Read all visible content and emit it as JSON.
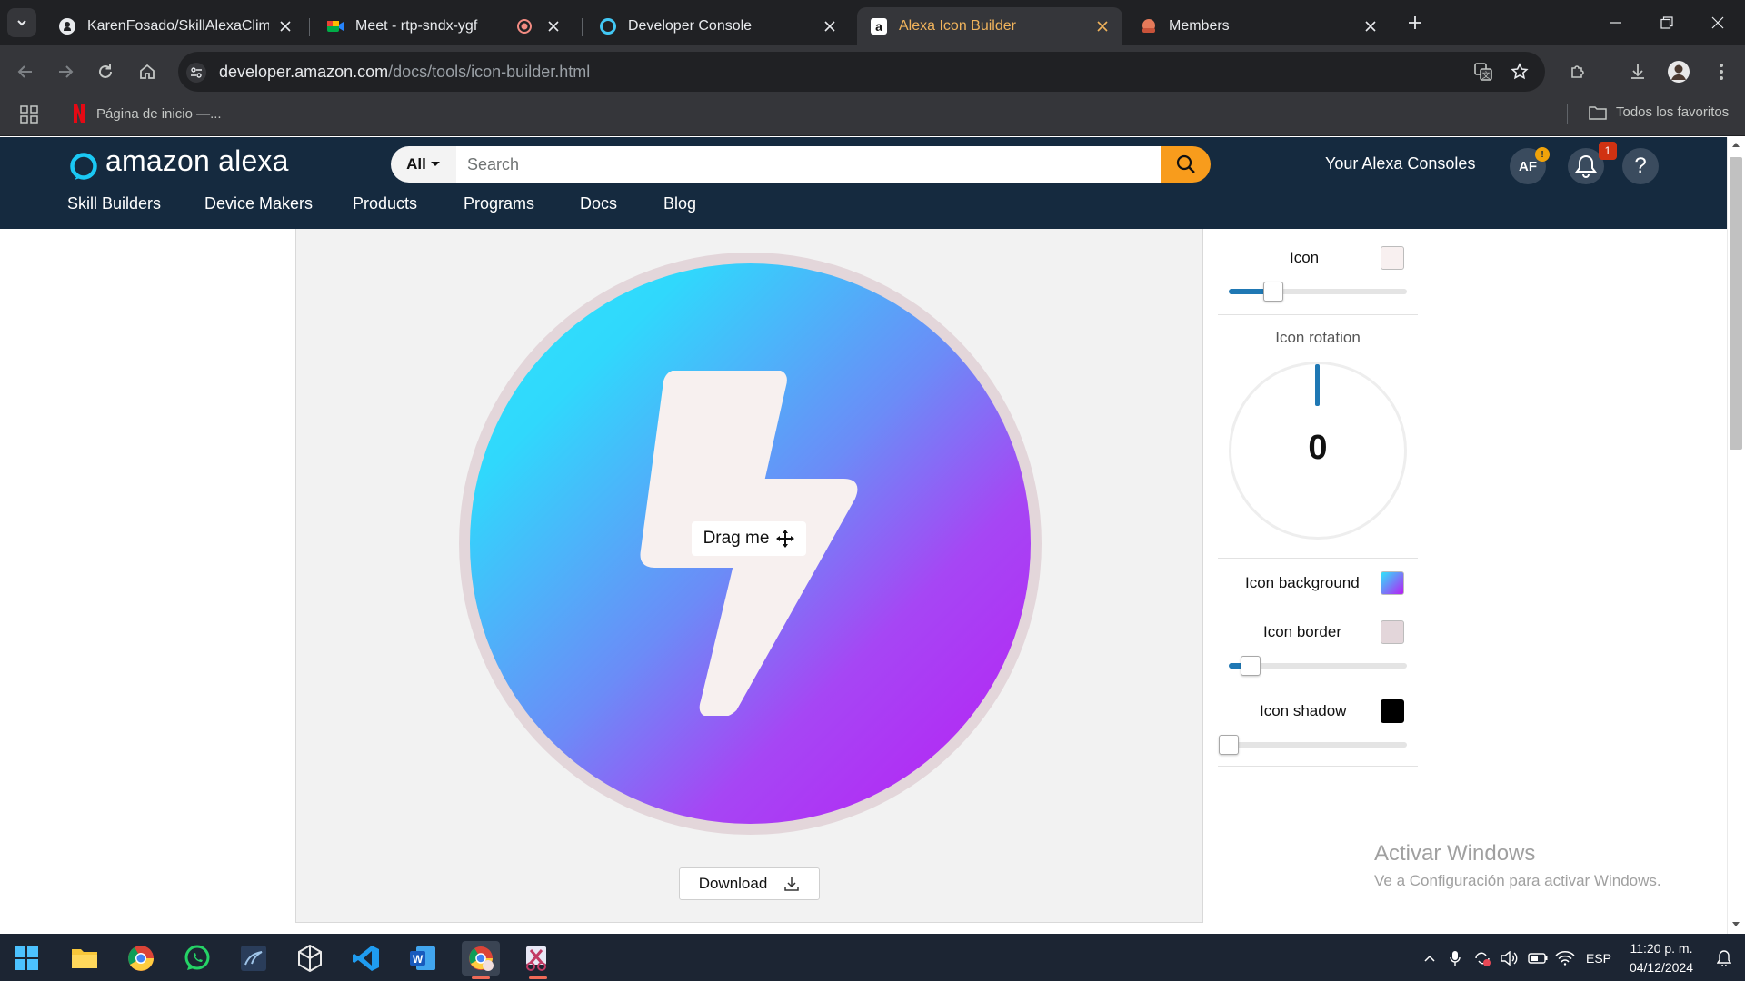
{
  "browser": {
    "tabs": [
      {
        "title": "KarenFosado/SkillAlexaClima: C",
        "icon": "github-icon"
      },
      {
        "title": "Meet - rtp-sndx-ygf",
        "icon": "meet-icon",
        "recording": true
      },
      {
        "title": "Developer Console",
        "icon": "alexa-ring-icon"
      },
      {
        "title": "Alexa Icon Builder",
        "icon": "amazon-icon",
        "active": true
      },
      {
        "title": "Members",
        "icon": "members-icon"
      }
    ],
    "url_host": "developer.amazon.com",
    "url_path": "/docs/tools/icon-builder.html",
    "bookmarks": {
      "netflix": "Página de inicio —...",
      "all_favorites": "Todos los favoritos"
    }
  },
  "site": {
    "logo": "amazon alexa",
    "search": {
      "scope": "All",
      "placeholder": "Search"
    },
    "consoles_link": "Your Alexa Consoles",
    "avatar_initials": "AF",
    "avatar_badge": "!",
    "notifications_count": "1",
    "help": "?",
    "nav": [
      "Skill Builders",
      "Device Makers",
      "Products",
      "Programs",
      "Docs",
      "Blog"
    ]
  },
  "builder": {
    "drag_label": "Drag me",
    "download_label": "Download",
    "panel": {
      "icon_label": "Icon",
      "icon_color": "#f8f0f0",
      "icon_size_level": 0.25,
      "rotation_label": "Icon rotation",
      "rotation_value": "0",
      "background_label": "Icon background",
      "background_gradient": [
        "#2ee5fb",
        "#b91cf4"
      ],
      "border_label": "Icon border",
      "border_color": "#e3d6da",
      "border_level": 0.13,
      "shadow_label": "Icon shadow",
      "shadow_color": "#000000",
      "shadow_level": 0.0
    }
  },
  "watermark": {
    "line1": "Activar Windows",
    "line2": "Ve a Configuración para activar Windows."
  },
  "taskbar": {
    "apps": [
      "windows-start",
      "file-explorer",
      "chrome",
      "whatsapp",
      "mysql-workbench",
      "unity",
      "vscode",
      "word",
      "chrome-profile",
      "snipping-tool"
    ],
    "lang": "ESP",
    "time": "11:20 p. m.",
    "date": "04/12/2024"
  }
}
